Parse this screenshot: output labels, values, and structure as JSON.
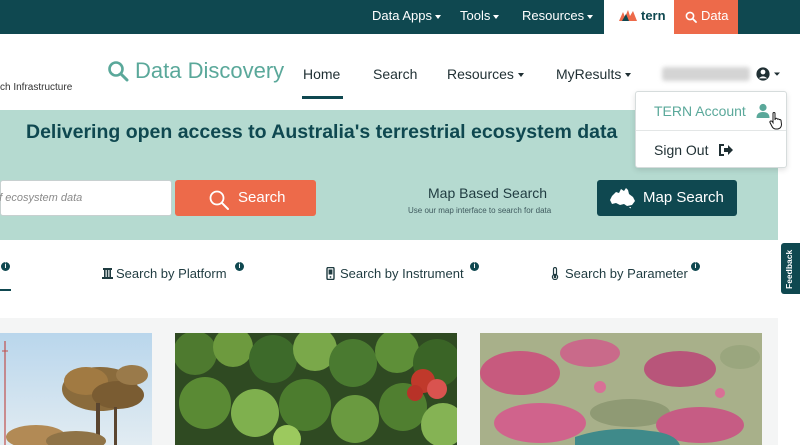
{
  "topbar": {
    "items": [
      {
        "label": "Data Apps"
      },
      {
        "label": "Tools"
      },
      {
        "label": "Resources"
      }
    ],
    "logo_text": "tern",
    "data_label": "Data"
  },
  "nav": {
    "brand_fragment": "ch Infrastructure",
    "title": "Data Discovery",
    "items": [
      {
        "label": "Home"
      },
      {
        "label": "Search"
      },
      {
        "label": "Resources"
      },
      {
        "label": "MyResults"
      }
    ]
  },
  "account_menu": {
    "items": [
      {
        "label": "TERN Account"
      },
      {
        "label": "Sign Out"
      }
    ]
  },
  "hero": {
    "title": "Delivering open access to Australia's terrestrial ecosystem data",
    "search_placeholder": "of ecosystem data",
    "search_button": "Search",
    "map_heading": "Map Based Search",
    "map_subtitle": "Use our map interface to search for data",
    "map_button": "Map Search"
  },
  "tabs": [
    {
      "label": "Search by Platform"
    },
    {
      "label": "Search by Instrument"
    },
    {
      "label": "Search by Parameter"
    }
  ],
  "feedback_label": "Feedback",
  "colors": {
    "primary": "#0f4850",
    "accent": "#ed6a4a",
    "hero_bg": "#b5dad0",
    "brand_green": "#5aa89a"
  }
}
